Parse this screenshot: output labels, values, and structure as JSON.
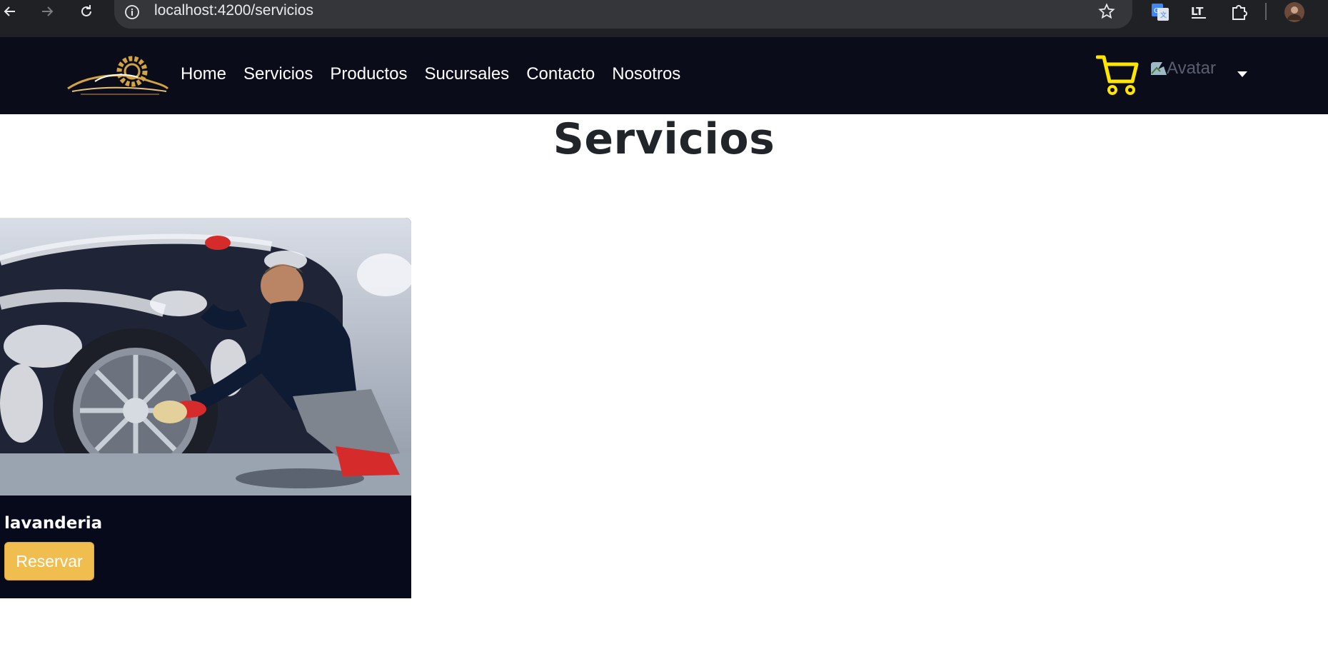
{
  "browser": {
    "url": "localhost:4200/servicios",
    "icons": [
      "back-arrow-icon",
      "forward-arrow-icon",
      "reload-icon",
      "site-info-icon",
      "bookmark-star-icon",
      "google-translate-icon",
      "languagetool-icon",
      "extensions-puzzle-icon",
      "profile-avatar-icon"
    ]
  },
  "navbar": {
    "logo_icon": "car-gear-logo-icon",
    "links": [
      "Home",
      "Servicios",
      "Productos",
      "Sucursales",
      "Contacto",
      "Nosotros"
    ],
    "cart_icon": "cart-icon",
    "cart_color": "#ffe600",
    "avatar_alt": "Avatar",
    "dropdown_icon": "caret-down-icon",
    "background": "#0a0c1a"
  },
  "main": {
    "title": "Servicios"
  },
  "services": [
    {
      "name": "lavanderia",
      "button_label": "Reservar",
      "image": "car-wash-photo"
    }
  ],
  "colors": {
    "accent": "#f0bd4f",
    "card_bg": "#070a1a"
  }
}
